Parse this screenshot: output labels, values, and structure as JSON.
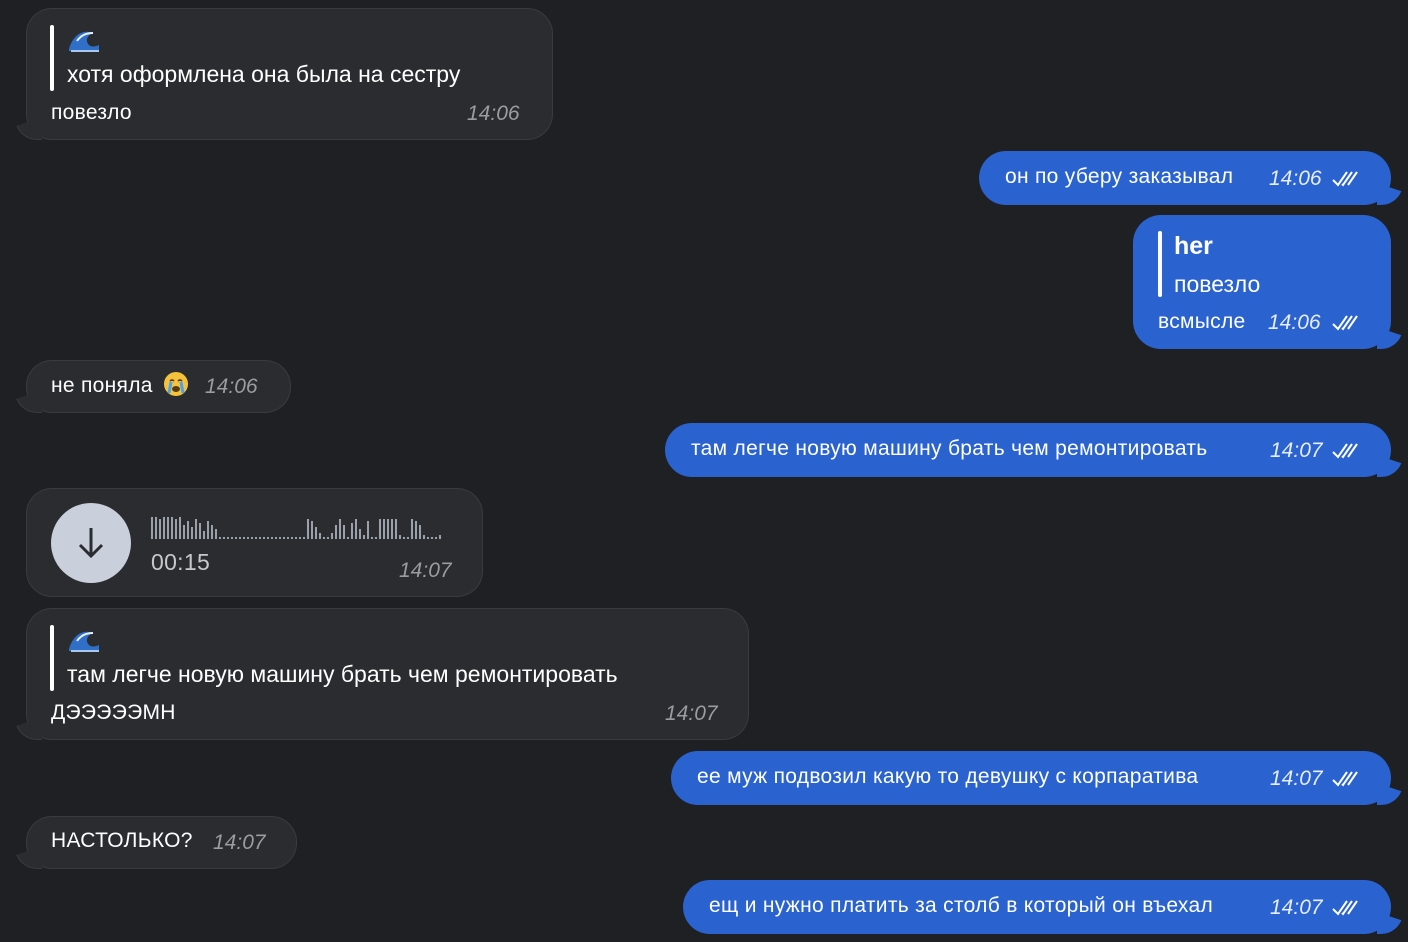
{
  "messages": [
    {
      "id": "m1",
      "side": "in",
      "quote_emoji": "wave-emoji",
      "quote_text": "хотя оформлена она была на сестру",
      "text": "повезло",
      "time": "14:06"
    },
    {
      "id": "m2",
      "side": "out",
      "text": "он по уберу заказывал",
      "time": "14:06"
    },
    {
      "id": "m3",
      "side": "out",
      "quote_author": "her",
      "quote_text": "повезло",
      "text": "всмысле",
      "time": "14:06"
    },
    {
      "id": "m4",
      "side": "in",
      "text": "не поняла",
      "emoji": "crying-face-emoji",
      "time": "14:06"
    },
    {
      "id": "m5",
      "side": "out",
      "text": "там легче новую машину брать чем ремонтировать",
      "time": "14:07"
    },
    {
      "id": "m6",
      "side": "in",
      "type": "voice",
      "duration": "00:15",
      "time": "14:07",
      "icon": "download-arrow-icon"
    },
    {
      "id": "m7",
      "side": "in",
      "quote_emoji": "wave-emoji",
      "quote_text": "там легче новую машину брать чем ремонтировать",
      "text": "ДЭЭЭЭЭМН",
      "time": "14:07"
    },
    {
      "id": "m8",
      "side": "out",
      "text": "ее муж подвозил какую то девушку  с корпаратива",
      "time": "14:07"
    },
    {
      "id": "m9",
      "side": "in",
      "text": "НАСТОЛЬКО?",
      "time": "14:07"
    },
    {
      "id": "m10",
      "side": "out",
      "text": "ещ и нужно платить за столб в который он въехал",
      "time": "14:07"
    }
  ],
  "colors": {
    "background": "#1e2024",
    "incoming": "#2b2c2f",
    "outgoing": "#2a62d0",
    "read_check": "#ffffff"
  }
}
